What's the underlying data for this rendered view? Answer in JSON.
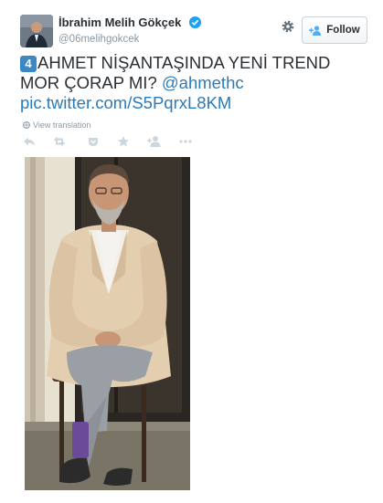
{
  "author": {
    "name": "İbrahim Melih Gökçek",
    "handle": "@06melihgokcek",
    "verified": true
  },
  "follow": {
    "label": "Follow",
    "icon": "add-person-icon"
  },
  "settings": {
    "icon": "gear-icon"
  },
  "tweet": {
    "badge": "4",
    "text_line1": "AHMET NİŞANTAŞINDA YENİ TREND",
    "text_line2": "MOR ÇORAP MI? ",
    "mention": "@ahmethc",
    "media_link": "pic.twitter.com/S5PqrxL8KM"
  },
  "translate": {
    "label": "View translation",
    "icon": "globe-icon"
  },
  "actions": [
    {
      "name": "reply-icon"
    },
    {
      "name": "retweet-icon"
    },
    {
      "name": "pocket-icon"
    },
    {
      "name": "favorite-star-icon"
    },
    {
      "name": "follow-user-icon"
    },
    {
      "name": "more-icon"
    }
  ],
  "colors": {
    "link": "#2b7bb9",
    "muted": "#8899a6",
    "verified": "#1da1f2",
    "badge": "#3b88c3"
  }
}
